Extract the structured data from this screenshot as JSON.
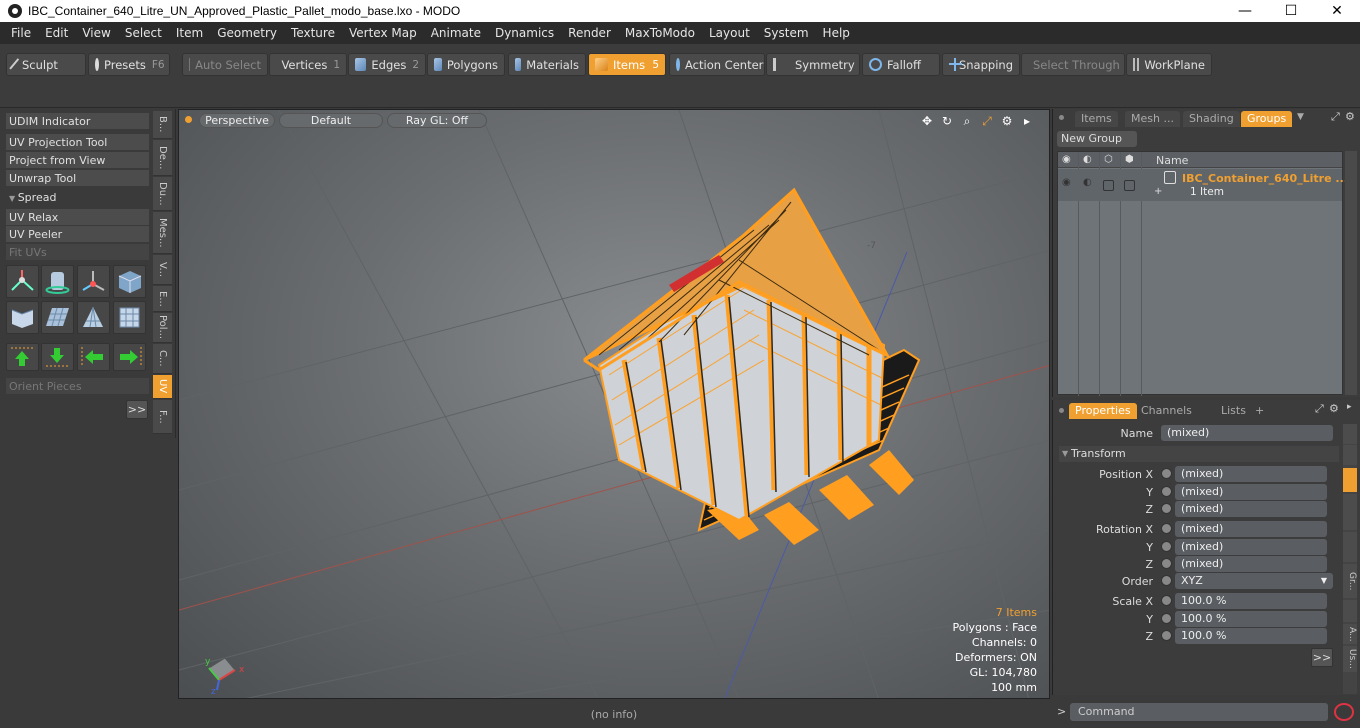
{
  "window": {
    "title": "IBC_Container_640_Litre_UN_Approved_Plastic_Pallet_modo_base.lxo - MODO",
    "minimize": "—",
    "maximize": "☐",
    "close": "✕"
  },
  "menu": [
    "File",
    "Edit",
    "View",
    "Select",
    "Item",
    "Geometry",
    "Texture",
    "Vertex Map",
    "Animate",
    "Dynamics",
    "Render",
    "MaxToModo",
    "Layout",
    "System",
    "Help"
  ],
  "toolbar": {
    "sculpt": "Sculpt",
    "presets": "Presets",
    "presets_key": "F6",
    "auto_select": "Auto Select",
    "vertices": "Vertices",
    "vertices_key": "1",
    "edges": "Edges",
    "edges_key": "2",
    "polygons": "Polygons",
    "materials": "Materials",
    "items": "Items",
    "items_key": "5",
    "action_center": "Action Center",
    "symmetry": "Symmetry",
    "falloff": "Falloff",
    "snapping": "Snapping",
    "select_through": "Select Through",
    "workplane": "WorkPlane"
  },
  "left_panel": {
    "items": [
      "UDIM Indicator",
      "UV Projection Tool",
      "Project from View",
      "Unwrap Tool"
    ],
    "spread": "Spread",
    "items2": [
      "UV Relax",
      "UV Peeler"
    ],
    "fit_uvs": "Fit UVs",
    "orient_pieces": "Orient Pieces",
    "more": ">>",
    "tabs": [
      "B...",
      "De...",
      "Du...",
      "Mes...",
      "V...",
      "E...",
      "Pol...",
      "C...",
      "UV",
      "F..."
    ]
  },
  "viewport": {
    "view": "Perspective",
    "style": "Default",
    "render": "Ray GL: Off",
    "items_count": "7 Items",
    "polygons": "Polygons : Face",
    "channels": "Channels: 0",
    "deformers": "Deformers: ON",
    "gl": "GL: 104,780",
    "scale": "100 mm"
  },
  "status": "(no info)",
  "groups_panel": {
    "tabs": [
      "Items",
      "Mesh ...",
      "Shading",
      "Groups"
    ],
    "new_group": "New Group",
    "column_name": "Name",
    "row_name": "IBC_Container_640_Litre ...",
    "row_sub": "1 Item"
  },
  "properties_panel": {
    "tabs": [
      "Properties",
      "Channels",
      "Lists"
    ],
    "add_tab": "+",
    "name_label": "Name",
    "name_value": "(mixed)",
    "transform": "Transform",
    "position_label": "Position X",
    "rotation_label": "Rotation X",
    "order_label": "Order",
    "order_value": "XYZ",
    "scale_label": "Scale X",
    "y": "Y",
    "z": "Z",
    "mixed": "(mixed)",
    "scale_value": "100.0 %",
    "more": ">>",
    "side_tabs": [
      "Gr...",
      "A...",
      "Us..."
    ]
  },
  "command": {
    "prompt": ">",
    "placeholder": "Command"
  },
  "colors": {
    "accent": "#f0a030",
    "wireframe": "#ff9e1f"
  }
}
